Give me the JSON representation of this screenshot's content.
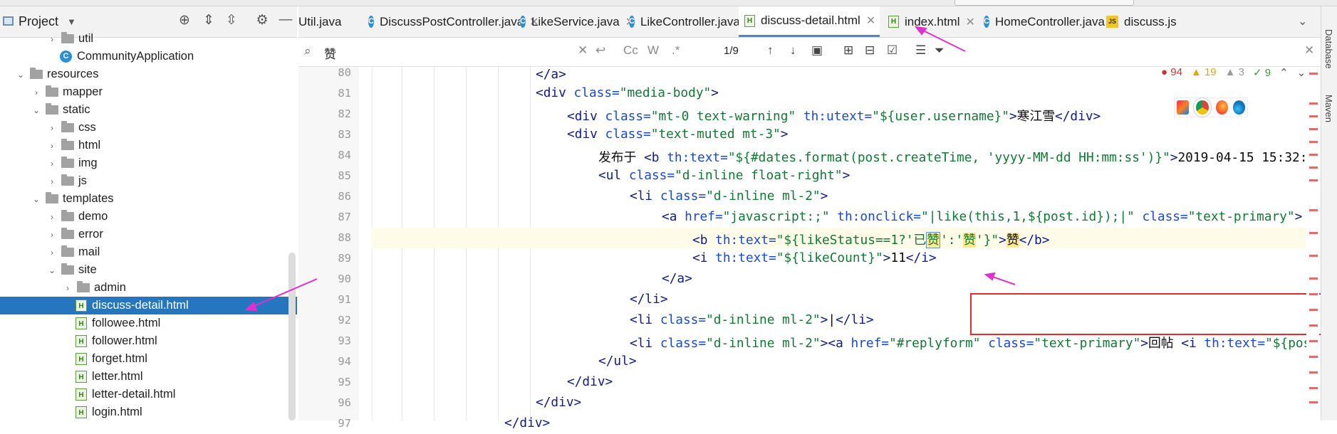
{
  "project": {
    "title": "Project",
    "items": [
      {
        "label": "util",
        "kind": "folder",
        "depth": 5,
        "arrow": "›"
      },
      {
        "label": "CommunityApplication",
        "kind": "class",
        "depth": 5,
        "arrow": ""
      },
      {
        "label": "resources",
        "kind": "folder",
        "depth": 3,
        "arrow": "⌄"
      },
      {
        "label": "mapper",
        "kind": "folder",
        "depth": 4,
        "arrow": "›"
      },
      {
        "label": "static",
        "kind": "folder",
        "depth": 4,
        "arrow": "⌄"
      },
      {
        "label": "css",
        "kind": "folder",
        "depth": 5,
        "arrow": "›"
      },
      {
        "label": "html",
        "kind": "folder",
        "depth": 5,
        "arrow": "›"
      },
      {
        "label": "img",
        "kind": "folder",
        "depth": 5,
        "arrow": "›"
      },
      {
        "label": "js",
        "kind": "folder",
        "depth": 5,
        "arrow": "›"
      },
      {
        "label": "templates",
        "kind": "folder",
        "depth": 4,
        "arrow": "⌄"
      },
      {
        "label": "demo",
        "kind": "folder",
        "depth": 5,
        "arrow": "›"
      },
      {
        "label": "error",
        "kind": "folder",
        "depth": 5,
        "arrow": "›"
      },
      {
        "label": "mail",
        "kind": "folder",
        "depth": 5,
        "arrow": "›"
      },
      {
        "label": "site",
        "kind": "folder",
        "depth": 5,
        "arrow": "⌄"
      },
      {
        "label": "admin",
        "kind": "folder",
        "depth": 6,
        "arrow": "›"
      },
      {
        "label": "discuss-detail.html",
        "kind": "html",
        "depth": 6,
        "arrow": "",
        "selected": true
      },
      {
        "label": "followee.html",
        "kind": "html",
        "depth": 6,
        "arrow": ""
      },
      {
        "label": "follower.html",
        "kind": "html",
        "depth": 6,
        "arrow": ""
      },
      {
        "label": "forget.html",
        "kind": "html",
        "depth": 6,
        "arrow": ""
      },
      {
        "label": "letter.html",
        "kind": "html",
        "depth": 6,
        "arrow": ""
      },
      {
        "label": "letter-detail.html",
        "kind": "html",
        "depth": 6,
        "arrow": ""
      },
      {
        "label": "login.html",
        "kind": "html",
        "depth": 6,
        "arrow": ""
      }
    ]
  },
  "tabs": [
    {
      "label": "Util.java",
      "icon": "",
      "close": false
    },
    {
      "label": "DiscussPostController.java",
      "icon": "C",
      "close": true
    },
    {
      "label": "LikeService.java",
      "icon": "C",
      "close": true
    },
    {
      "label": "LikeController.java",
      "icon": "C",
      "close": true
    },
    {
      "label": "discuss-detail.html",
      "icon": "H",
      "close": true,
      "active": true
    },
    {
      "label": "index.html",
      "icon": "H",
      "close": true
    },
    {
      "label": "HomeController.java",
      "icon": "C",
      "close": true
    },
    {
      "label": "discuss.js",
      "icon": "JS",
      "close": false
    }
  ],
  "search": {
    "query": "赞",
    "count": "1/9",
    "opt_cc": "Cc",
    "opt_w": "W",
    "opt_regex": ".*"
  },
  "inspections": {
    "errors": "94",
    "warnings": "19",
    "weak": "3",
    "ok": "9"
  },
  "line_numbers": [
    "80",
    "81",
    "82",
    "83",
    "84",
    "85",
    "86",
    "87",
    "88",
    "89",
    "90",
    "91",
    "92",
    "93",
    "94",
    "95",
    "96",
    "97"
  ],
  "code": {
    "l80_a": "</a>",
    "l81_a": "<div ",
    "l81_b": "class=",
    "l81_c": "\"media-body\"",
    "l81_d": ">",
    "l82_a": "<div ",
    "l82_b": "class=",
    "l82_c": "\"mt-0 text-warning\" ",
    "l82_d": "th:utext=",
    "l82_e": "\"${user.username}\"",
    "l82_f": ">",
    "l82_g": "寒江雪",
    "l82_h": "</div>",
    "l83_a": "<div ",
    "l83_b": "class=",
    "l83_c": "\"text-muted mt-3\"",
    "l83_d": ">",
    "l84_a": "发布于 ",
    "l84_b": "<b ",
    "l84_c": "th:text=",
    "l84_d": "\"${#dates.format(post.createTime, 'yyyy-MM-dd HH:mm:ss')}\"",
    "l84_e": ">",
    "l84_f": "2019-04-15 15:32:",
    "l85_a": "<ul ",
    "l85_b": "class=",
    "l85_c": "\"d-inline float-right\"",
    "l85_d": ">",
    "l86_a": "<li ",
    "l86_b": "class=",
    "l86_c": "\"d-inline ml-2\"",
    "l86_d": ">",
    "l87_a": "<a ",
    "l87_b": "href=",
    "l87_c": "\"javascript:;\" ",
    "l87_d": "th:onclick=",
    "l87_e": "\"|like(this,1,${post.id});|\" ",
    "l87_f": "class=",
    "l87_g": "\"text-primary\"",
    "l87_h": ">",
    "l88_a": "<b ",
    "l88_b": "th:text=",
    "l88_c": "\"${likeStatus==1?'已",
    "l88_d": "赞",
    "l88_e": "':'",
    "l88_f": "赞",
    "l88_g": "'}\"",
    "l88_h": ">",
    "l88_i": "赞",
    "l88_j": "</b>",
    "l89_a": "<i ",
    "l89_b": "th:text=",
    "l89_c": "\"${likeCount}\"",
    "l89_d": ">",
    "l89_e": "11",
    "l89_f": "</i>",
    "l90_a": "</a>",
    "l91_a": "</li>",
    "l92_a": "<li ",
    "l92_b": "class=",
    "l92_c": "\"d-inline ml-2\"",
    "l92_d": ">",
    "l92_e": "|",
    "l92_f": "</li>",
    "l93_a": "<li ",
    "l93_b": "class=",
    "l93_c": "\"d-inline ml-2\"",
    "l93_d": "><a ",
    "l93_e": "href=",
    "l93_f": "\"#replyform\" ",
    "l93_g": "class=",
    "l93_h": "\"text-primary\"",
    "l93_i": ">",
    "l93_j": "回帖 ",
    "l93_k": "<i ",
    "l93_l": "th:text=",
    "l93_m": "\"${pos",
    "l94_a": "</ul>",
    "l95_a": "</div>",
    "l96_a": "</div>",
    "l97_a": "</div>"
  },
  "side_tools": {
    "database": "Database",
    "maven": "Maven"
  }
}
